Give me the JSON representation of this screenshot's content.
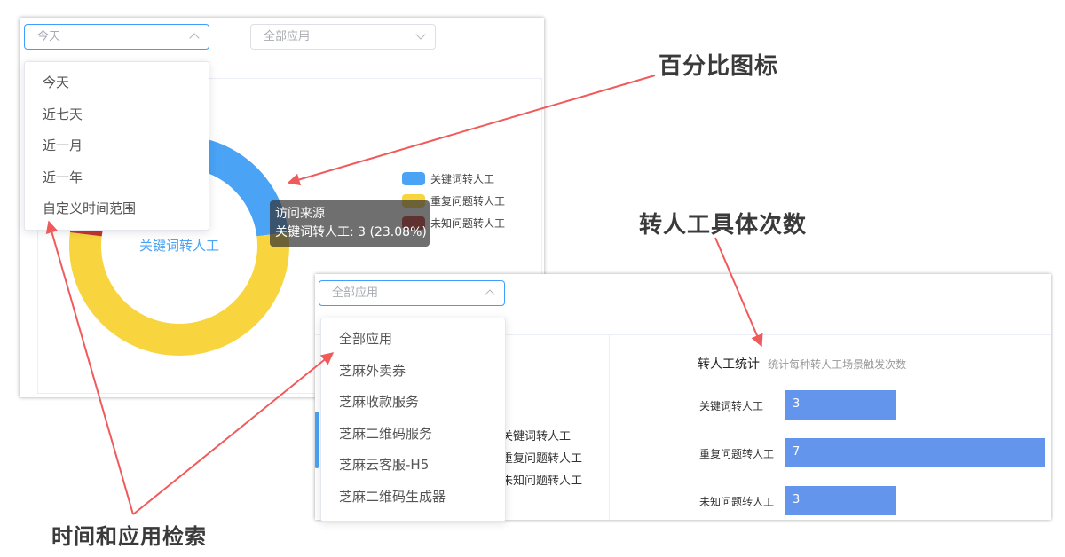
{
  "colors": {
    "accent": "#409eff",
    "series_keyword": "#4aa3f5",
    "series_repeat": "#f8d43e",
    "series_unknown": "#c23531",
    "bar": "#6495ed",
    "arrow": "#f05a5a"
  },
  "top_panel": {
    "date_select": {
      "value": "今天"
    },
    "app_select": {
      "value": "全部应用"
    },
    "date_options": [
      "今天",
      "近七天",
      "近一月",
      "近一年",
      "自定义时间范围"
    ],
    "donut_center_label": "关键词转人工",
    "legend": [
      "关键词转人工",
      "重复问题转人工",
      "未知问题转人工"
    ],
    "tooltip": {
      "title": "访问来源",
      "line": "关键词转人工: 3 (23.08%)"
    }
  },
  "chart_data": [
    {
      "type": "pie",
      "categories": [
        "关键词转人工",
        "重复问题转人工",
        "未知问题转人工"
      ],
      "values": [
        3,
        7,
        3
      ],
      "title": "",
      "note": "访问来源"
    },
    {
      "type": "bar",
      "title": "转人工统计",
      "subtitle": "统计每种转人工场景触发次数",
      "categories": [
        "关键词转人工",
        "重复问题转人工",
        "未知问题转人工"
      ],
      "values": [
        3,
        7,
        3
      ],
      "xlim": [
        0,
        7
      ]
    }
  ],
  "bottom_panel": {
    "app_select": {
      "value": "全部应用"
    },
    "app_options": [
      "全部应用",
      "芝麻外卖券",
      "芝麻收款服务",
      "芝麻二维码服务",
      "芝麻云客服-H5",
      "芝麻二维码生成器"
    ],
    "legend_partial": [
      "关键词转人工",
      "重复问题转人工",
      "未知问题转人工"
    ],
    "stats_title": "转人工统计",
    "stats_subtitle": "统计每种转人工场景触发次数"
  },
  "annotations": {
    "percent_icon": "百分比图标",
    "transfer_count": "转人工具体次数",
    "search_filter": "时间和应用检索"
  }
}
